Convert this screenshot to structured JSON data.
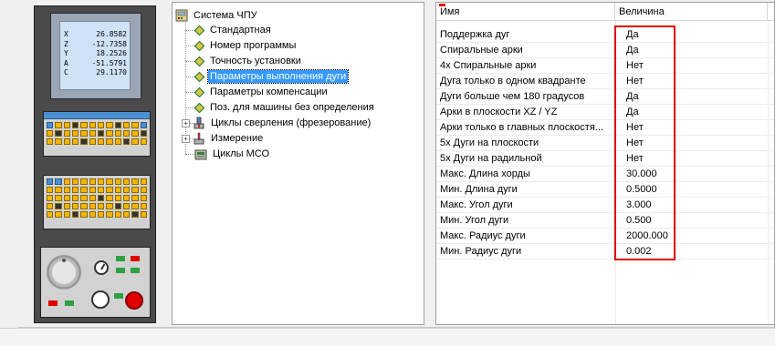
{
  "screen": {
    "coords": [
      {
        "axis": "X",
        "value": "26.8582"
      },
      {
        "axis": "Z",
        "value": "-12.7358"
      },
      {
        "axis": "Y",
        "value": "18.2526"
      },
      {
        "axis": "A",
        "value": "-51.5791"
      },
      {
        "axis": "C",
        "value": "29.1170"
      }
    ]
  },
  "tree": {
    "root_label": "Система ЧПУ",
    "items": [
      {
        "label": "Стандартная"
      },
      {
        "label": "Номер программы"
      },
      {
        "label": "Точность установки"
      },
      {
        "label": "Параметры выполнения дуги"
      },
      {
        "label": "Параметры компенсации"
      },
      {
        "label": "Поз. для машины без определения"
      },
      {
        "label": "Циклы сверления (фрезерование)"
      },
      {
        "label": "Измерение"
      },
      {
        "label": "Циклы МСО"
      }
    ]
  },
  "table": {
    "headers": {
      "name": "Имя",
      "value": "Величина"
    },
    "rows": [
      {
        "name": "Поддержка дуг",
        "value": "Да"
      },
      {
        "name": "Спиральные арки",
        "value": "Да"
      },
      {
        "name": "4х Спиральные арки",
        "value": "Нет"
      },
      {
        "name": "Дуга только в одном квадранте",
        "value": "Нет"
      },
      {
        "name": "Дуги больше чем 180 градусов",
        "value": "Да"
      },
      {
        "name": "Арки в  плоскости XZ / YZ",
        "value": "Да"
      },
      {
        "name": "Арки только в  главных плоскостя...",
        "value": "Нет"
      },
      {
        "name": "5х Дуги на плоскости",
        "value": "Нет"
      },
      {
        "name": "5х Дуги на радильной",
        "value": "Нет"
      },
      {
        "name": "Макс. Длина хорды",
        "value": "30.000"
      },
      {
        "name": "Мин. Длина дуги",
        "value": "0.5000"
      },
      {
        "name": "Макс.  Угол дуги",
        "value": "3.000"
      },
      {
        "name": "Мин.  Угол дуги",
        "value": "0.500"
      },
      {
        "name": "Макс. Радиус дуги",
        "value": "2000.000"
      },
      {
        "name": "Мин. Радиус дуги",
        "value": "0.002"
      }
    ]
  },
  "colors": {
    "highlight": "#e10000",
    "selection": "#3399ff",
    "key": "#f5b400",
    "screen": "#cfe2f6"
  }
}
